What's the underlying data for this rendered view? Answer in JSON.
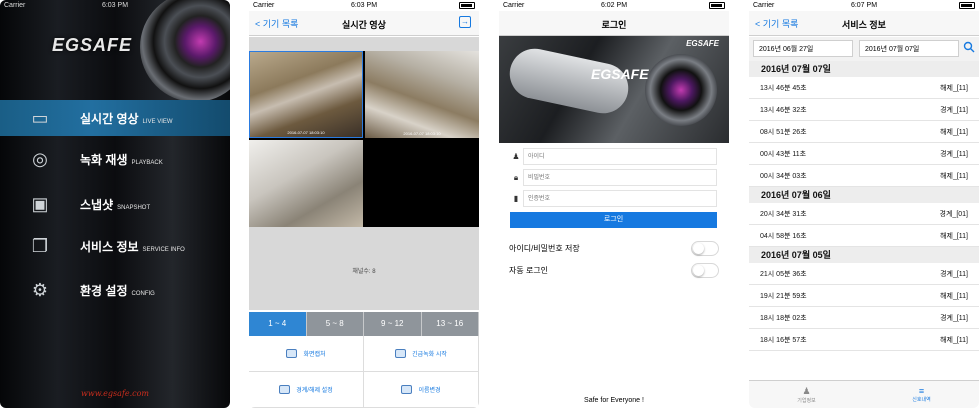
{
  "status": {
    "carrier": "Carrier",
    "screens": [
      {
        "time": "6:03 PM"
      },
      {
        "time": "6:03 PM"
      },
      {
        "time": "6:02 PM"
      },
      {
        "time": "6:07 PM"
      }
    ]
  },
  "screen1": {
    "logo": "EGSAFE",
    "menu": [
      {
        "ko": "실시간 영상",
        "en": "LIVE VIEW",
        "icon": "monitor-icon"
      },
      {
        "ko": "녹화 재생",
        "en": "PLAYBACK",
        "icon": "film-reel-icon"
      },
      {
        "ko": "스냅샷",
        "en": "SNAPSHOT",
        "icon": "photo-icon"
      },
      {
        "ko": "서비스 정보",
        "en": "SERVICE INFO",
        "icon": "info-card-icon"
      },
      {
        "ko": "환경 설정",
        "en": "CONFIG",
        "icon": "gear-icon"
      }
    ],
    "website": "www.egsafe.com"
  },
  "screen2": {
    "back_label": "기기 목록",
    "title": "실시간 영상",
    "cameras": [
      {
        "timestamp": "2016-07-07 18:03:10"
      },
      {
        "timestamp": "2016-07-07 18:03:10"
      },
      {
        "timestamp": ""
      },
      {
        "timestamp": ""
      }
    ],
    "channels_label": "채널수: 8",
    "tabs": [
      "1 ~ 4",
      "5 ~ 8",
      "9 ~ 12",
      "13 ~ 16"
    ],
    "actions": [
      "화면캡처",
      "긴급녹화 시작",
      "경계/해제 설정",
      "이름변경"
    ]
  },
  "screen3": {
    "title": "로그인",
    "logo": "EGSAFE",
    "fields": [
      {
        "placeholder": "아이디",
        "icon": "user-icon"
      },
      {
        "placeholder": "비밀번호",
        "icon": "lock-icon"
      },
      {
        "placeholder": "인증번호",
        "icon": "device-icon"
      }
    ],
    "login_button": "로그인",
    "toggles": [
      {
        "label": "아이디/비밀번호 저장",
        "on": false
      },
      {
        "label": "자동 로그인",
        "on": false
      }
    ],
    "footer": "Safe for Everyone !"
  },
  "screen4": {
    "back_label": "기기 목록",
    "title": "서비스 정보",
    "date_from": "2016년 06월 27일",
    "date_to": "2016년 07월 07일",
    "sections": [
      {
        "date": "2016년 07월 07일",
        "rows": [
          {
            "time": "13시 46분 45초",
            "event": "해제_[11]"
          },
          {
            "time": "13시 46분 32초",
            "event": "경계_[11]"
          },
          {
            "time": "08시 51분 26초",
            "event": "해제_[11]"
          },
          {
            "time": "00시 43분 11초",
            "event": "경계_[11]"
          },
          {
            "time": "00시 34분 03초",
            "event": "해제_[11]"
          }
        ]
      },
      {
        "date": "2016년 07월 06일",
        "rows": [
          {
            "time": "20시 34분 31초",
            "event": "경계_[01]"
          },
          {
            "time": "04시 58분 16초",
            "event": "해제_[11]"
          }
        ]
      },
      {
        "date": "2016년 07월 05일",
        "rows": [
          {
            "time": "21시 05분 36초",
            "event": "경계_[11]"
          },
          {
            "time": "19시 21분 59초",
            "event": "해제_[11]"
          },
          {
            "time": "18시 18분 02초",
            "event": "경계_[11]"
          },
          {
            "time": "18시 16분 57초",
            "event": "해제_[11]"
          }
        ]
      }
    ],
    "tabbar": [
      {
        "label": "기업정보",
        "icon": "person-icon",
        "active": false
      },
      {
        "label": "신호내역",
        "icon": "list-icon",
        "active": true
      }
    ]
  }
}
